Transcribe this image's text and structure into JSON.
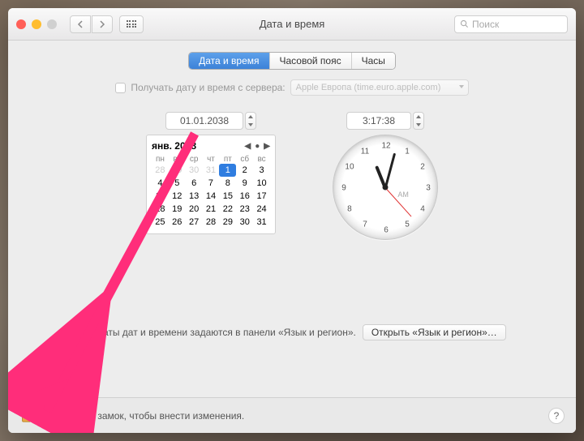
{
  "window": {
    "title": "Дата и время",
    "search_placeholder": "Поиск"
  },
  "tabs": {
    "date_time": "Дата и время",
    "time_zone": "Часовой пояс",
    "clock": "Часы"
  },
  "server_row": {
    "checkbox_label": "Получать дату и время с сервера:",
    "server_value": "Apple Европа (time.euro.apple.com)"
  },
  "date": {
    "field": "01.01.2038",
    "cal_title": "янв. 2038",
    "dow": [
      "пн",
      "вт",
      "ср",
      "чт",
      "пт",
      "сб",
      "вс"
    ],
    "prev": [
      "28",
      "29",
      "30",
      "31"
    ],
    "days": [
      "1",
      "2",
      "3",
      "4",
      "5",
      "6",
      "7",
      "8",
      "9",
      "10",
      "11",
      "12",
      "13",
      "14",
      "15",
      "16",
      "17",
      "18",
      "19",
      "20",
      "21",
      "22",
      "23",
      "24",
      "25",
      "26",
      "27",
      "28",
      "29",
      "30",
      "31"
    ],
    "selected": "1"
  },
  "time": {
    "field": "3:17:38",
    "ampm": "AM",
    "hour_angle": -22,
    "minute_angle": 15,
    "second_angle": 138,
    "numerals": [
      "12",
      "1",
      "2",
      "3",
      "4",
      "5",
      "6",
      "7",
      "8",
      "9",
      "10",
      "11"
    ]
  },
  "format_row": {
    "text": "Форматы дат и времени задаются в панели «Язык и регион».",
    "button": "Открыть «Язык и регион»…"
  },
  "footer": {
    "lock_text": "Нажмите на замок, чтобы внести изменения.",
    "help": "?"
  }
}
